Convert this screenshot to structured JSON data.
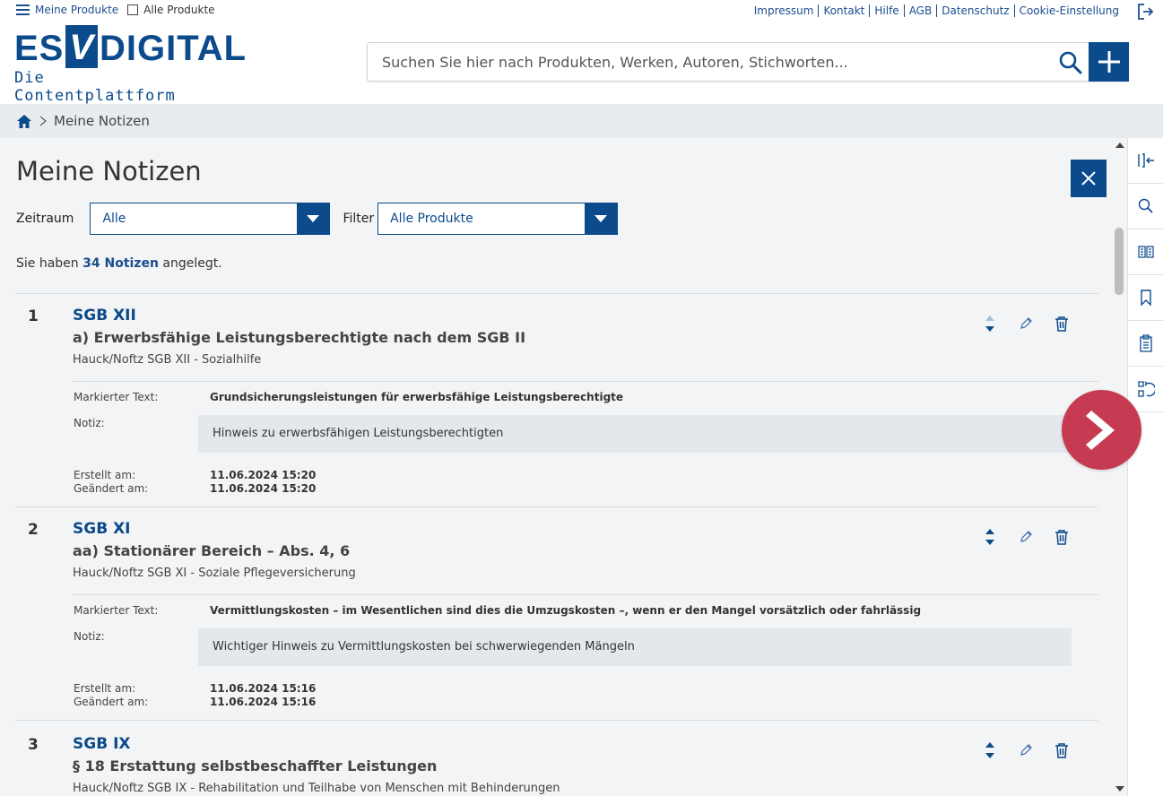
{
  "topbar": {
    "meine_produkte": "Meine Produkte",
    "alle_produkte": "Alle Produkte",
    "links": [
      "Impressum",
      "Kontakt",
      "Hilfe",
      "AGB",
      "Datenschutz",
      "Cookie-Einstellung"
    ]
  },
  "logo": {
    "part1": "ES",
    "v": "V",
    "part2": "DIGITAL",
    "sub": "Die Contentplattform"
  },
  "search": {
    "placeholder": "Suchen Sie hier nach Produkten, Werken, Autoren, Stichworten..."
  },
  "breadcrumb": {
    "current": "Meine Notizen"
  },
  "page": {
    "title": "Meine Notizen",
    "zeitraum_label": "Zeitraum",
    "zeitraum_value": "Alle",
    "filter_label": "Filter",
    "filter_value": "Alle Produkte",
    "count_prefix": "Sie haben ",
    "count_value": "34 Notizen",
    "count_suffix": " angelegt."
  },
  "labels": {
    "markiert": "Markierter Text:",
    "notiz": "Notiz:",
    "erstellt": "Erstellt am:",
    "geaendert": "Geändert am:"
  },
  "notes": [
    {
      "num": "1",
      "product": "SGB XII",
      "title": "a) Erwerbsfähige Leistungsberechtigte nach dem SGB II",
      "book": "Hauck/Noftz SGB XII - Sozialhilfe",
      "marked": "Grundsicherungsleistungen für erwerbsfähige Leistungsberechtigte",
      "note": "Hinweis zu erwerbsfähigen Leistungsberechtigten",
      "created": "11.06.2024 15:20",
      "changed": "11.06.2024 15:20"
    },
    {
      "num": "2",
      "product": "SGB XI",
      "title": "aa) Stationärer Bereich – Abs. 4, 6",
      "book": "Hauck/Noftz SGB XI - Soziale Pflegeversicherung",
      "marked": "Vermittlungskosten – im Wesentlichen sind dies die Umzugskosten –, wenn er den Mangel vorsätzlich oder fahrlässig",
      "note": "Wichtiger Hinweis zu Vermittlungskosten bei schwerwiegenden Mängeln",
      "created": "11.06.2024 15:16",
      "changed": "11.06.2024 15:16"
    },
    {
      "num": "3",
      "product": "SGB IX",
      "title": "§ 18 Erstattung selbstbeschaffter Leistungen",
      "book": "Hauck/Noftz SGB IX - Rehabilitation und Teilhabe von Menschen mit Behinderungen"
    }
  ],
  "colors": {
    "brand": "#0b4a8b",
    "next": "#c73b52",
    "background": "#f3f4f5"
  },
  "icons": {
    "sidebar": [
      "collapse-panel-icon",
      "search-icon",
      "book-icon",
      "bookmark-icon",
      "clipboard-icon",
      "history-icon"
    ]
  }
}
